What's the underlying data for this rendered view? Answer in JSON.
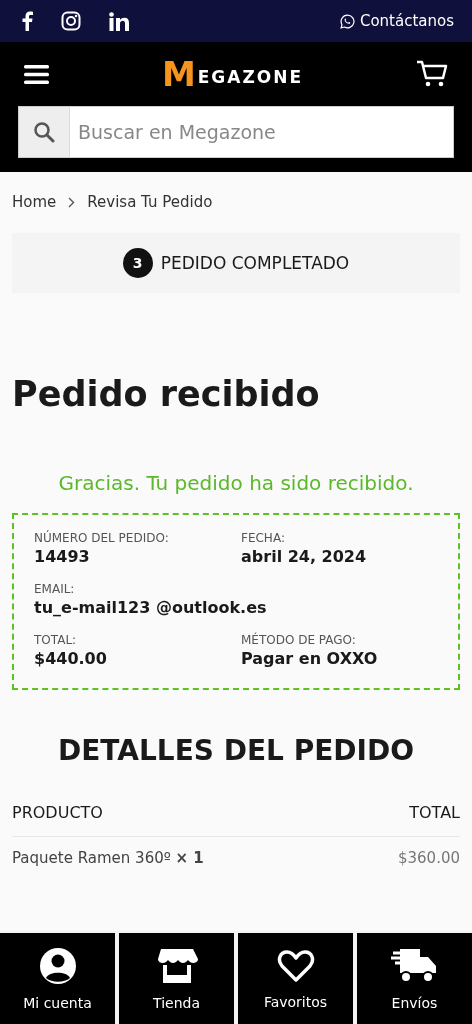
{
  "top_bar": {
    "contact": "Contáctanos"
  },
  "header": {
    "logo": {
      "initial": "M",
      "rest": "EGAZONE"
    },
    "search": {
      "placeholder": "Buscar en Megazone"
    }
  },
  "breadcrumb": [
    {
      "label": "Home"
    },
    {
      "label": "Revisa Tu Pedido"
    }
  ],
  "step": {
    "number": "3",
    "label": "PEDIDO COMPLETADO"
  },
  "title": "Pedido recibido",
  "thanks": "Gracias. Tu pedido ha sido recibido.",
  "summary": [
    [
      {
        "label": "NÚMERO DEL PEDIDO:",
        "value": "14493"
      },
      {
        "label": "FECHA:",
        "value": "abril 24, 2024"
      }
    ],
    [
      {
        "label": "EMAIL:",
        "value": "tu_e-mail123 @outlook.es"
      }
    ],
    [
      {
        "label": "TOTAL:",
        "value": "$440.00"
      },
      {
        "label": "MÉTODO DE PAGO:",
        "value": "Pagar en OXXO"
      }
    ]
  ],
  "details": {
    "title": "DETALLES DEL PEDIDO",
    "columns": [
      "PRODUCTO",
      "TOTAL"
    ],
    "rows": [
      {
        "product": "Paquete Ramen 360º **× 1**",
        "total": "$360.00"
      }
    ]
  },
  "bottom_nav": [
    {
      "kind": "account",
      "label": "Mi cuenta"
    },
    {
      "kind": "store",
      "label": "Tienda"
    },
    {
      "kind": "heart",
      "label": "Favoritos"
    },
    {
      "kind": "truck",
      "label": "Envíos"
    }
  ]
}
